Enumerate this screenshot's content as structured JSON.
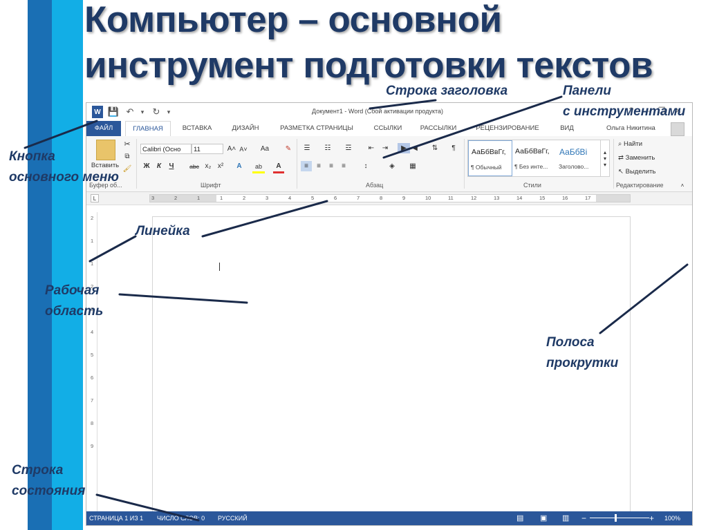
{
  "title": "Компьютер – основной\nинструмент подготовки текстов",
  "annotations": {
    "title_bar": "Строка заголовка",
    "toolbars": "Панели\nс инструментами",
    "main_menu_button": "Кнопка\nосновного меню",
    "ruler": "Линейка",
    "workspace": "Рабочая\nобласть",
    "scrollbar": "Полоса\nпрокрутки",
    "status_bar": "Строка\nсостояния"
  },
  "word": {
    "window_title": "Документ1 - Word (Сбой активации продукта)",
    "quick_access": {
      "word_icon": "W",
      "save_icon": "💾",
      "undo_icon": "↶",
      "redo_icon": "↻",
      "more_icon": "▾"
    },
    "window_buttons": {
      "help": "?",
      "minimize": "—",
      "maximize": "❐",
      "close": "✕"
    },
    "tabs": [
      "ФАЙЛ",
      "ГЛАВНАЯ",
      "ВСТАВКА",
      "ДИЗАЙН",
      "РАЗМЕТКА СТРАНИЦЫ",
      "ССЫЛКИ",
      "РАССЫЛКИ",
      "РЕЦЕНЗИРОВАНИЕ",
      "ВИД"
    ],
    "active_tab": "ГЛАВНАЯ",
    "user_name": "Ольга Никитина",
    "ribbon": {
      "clipboard": {
        "paste": "Вставить",
        "label": "Буфер об..."
      },
      "font": {
        "name": "Calibri (Осно",
        "size": "11",
        "bold": "Ж",
        "italic": "К",
        "underline": "Ч",
        "strike": "abc",
        "subscript": "x₂",
        "superscript": "x²",
        "grow": "A˄",
        "shrink": "A˅",
        "case": "Aa",
        "highlight": "ab",
        "color": "A",
        "text_effects": "A",
        "label": "Шрифт"
      },
      "paragraph": {
        "label": "Абзац"
      },
      "styles": {
        "items": [
          {
            "sample": "АаБбВвГг,",
            "name": "¶ Обычный"
          },
          {
            "sample": "АаБбВвГг,",
            "name": "¶ Без инте..."
          },
          {
            "sample": "АаБбВі",
            "name": "Заголово..."
          }
        ],
        "label": "Стили"
      },
      "editing": {
        "find": "Найти",
        "replace": "Заменить",
        "select": "Выделить",
        "label": "Редактирование"
      }
    },
    "ruler_numbers": [
      "3",
      "2",
      "1",
      "1",
      "2",
      "3",
      "4",
      "5",
      "6",
      "7",
      "8",
      "9",
      "10",
      "11",
      "12",
      "13",
      "14",
      "15",
      "16",
      "17"
    ],
    "vruler_numbers": [
      "2",
      "1",
      "1",
      "2",
      "3",
      "4",
      "5",
      "6",
      "7",
      "8",
      "9"
    ],
    "status": {
      "page": "СТРАНИЦА 1 ИЗ 1",
      "words": "ЧИСЛО СЛОВ: 0",
      "language": "РУССКИЙ",
      "zoom_minus": "−",
      "zoom_plus": "+",
      "zoom": "100%"
    }
  },
  "colors": {
    "accent": "#2b579a",
    "stripe_dark": "#1a6fb4",
    "stripe_light": "#12aee6",
    "title": "#1f3a66"
  }
}
